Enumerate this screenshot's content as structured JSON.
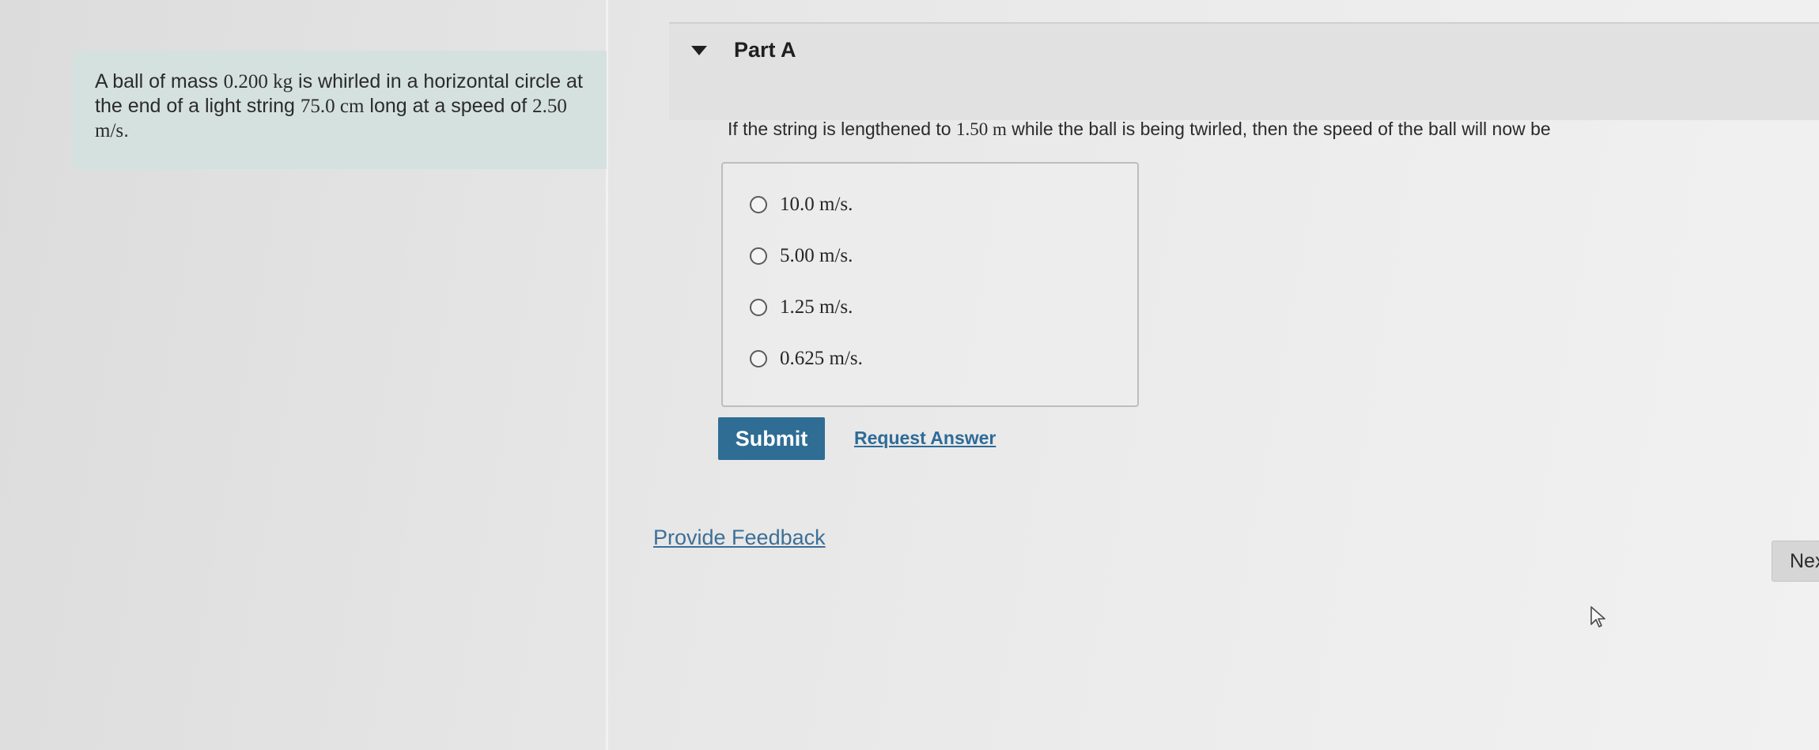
{
  "problem": {
    "text_1": "A ball of mass ",
    "mass": "0.200 kg",
    "text_2": " is whirled in a horizontal circle at the end of a light string ",
    "length": "75.0 cm",
    "text_3": " long at a speed of ",
    "speed": "2.50 m/s",
    "text_4": "."
  },
  "part": {
    "title": "Part A",
    "question_1": "If the string is lengthened to ",
    "question_length": "1.50 m",
    "question_2": " while the ball is being twirled, then the speed of the ball will now be"
  },
  "options": [
    {
      "label": "10.0 m/s."
    },
    {
      "label": "5.00 m/s."
    },
    {
      "label": "1.25 m/s."
    },
    {
      "label": "0.625 m/s."
    }
  ],
  "actions": {
    "submit_label": "Submit",
    "request_label": "Request Answer",
    "feedback_label": "Provide Feedback",
    "next_label": "Next"
  },
  "icons": {
    "collapse": "caret-down-icon",
    "pointer": "mouse-cursor-icon"
  }
}
